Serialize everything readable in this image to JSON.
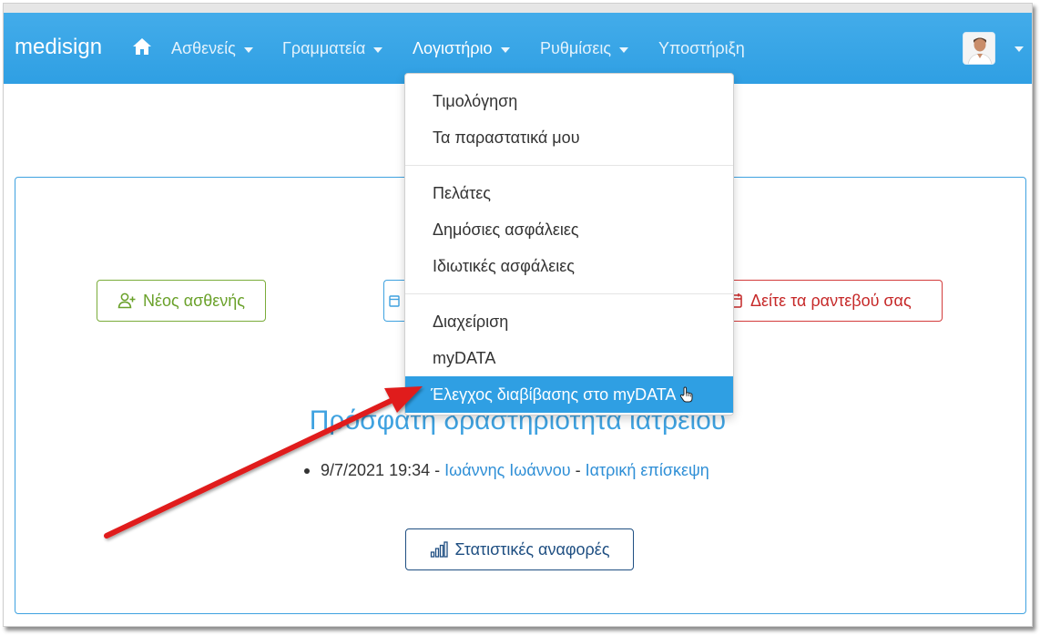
{
  "brand": "medisign",
  "nav": {
    "items": [
      {
        "label": "Ασθενείς",
        "has_caret": true
      },
      {
        "label": "Γραμματεία",
        "has_caret": true
      },
      {
        "label": "Λογιστήριο",
        "has_caret": true
      },
      {
        "label": "Ρυθμίσεις",
        "has_caret": true
      },
      {
        "label": "Υποστήριξη",
        "has_caret": false
      }
    ],
    "home_icon": "home-icon",
    "user_icon": "user-avatar"
  },
  "dropdown": {
    "items": [
      "Τιμολόγηση",
      "Τα παραστατικά μου",
      "Πελάτες",
      "Δημόσιες ασφάλειες",
      "Ιδιωτικές ασφάλειες",
      "Διαχείριση",
      "myDATA",
      "Έλεγχος διαβίβασης στο myDATA"
    ],
    "highlighted": "Έλεγχος διαβίβασης στο myDATA"
  },
  "actions": {
    "new_patient": "Νέος ασθενής",
    "appointments": "Δείτε τα ραντεβού σας",
    "statistics": "Στατιστικές αναφορές"
  },
  "activity": {
    "title": "Πρόσφατη δραστηριότητα ιατρείου",
    "entries": [
      {
        "datetime": "9/7/2021 19:34",
        "patient": "Ιωάννης Ιωάννου",
        "type": "Ιατρική επίσκεψη"
      }
    ]
  },
  "colors": {
    "navbar": "#2f9fe3",
    "highlight": "#2f9fe3",
    "green": "#6aa12a",
    "red": "#c62828",
    "navy": "#1f4f82",
    "arrow": "#e01b1b"
  }
}
